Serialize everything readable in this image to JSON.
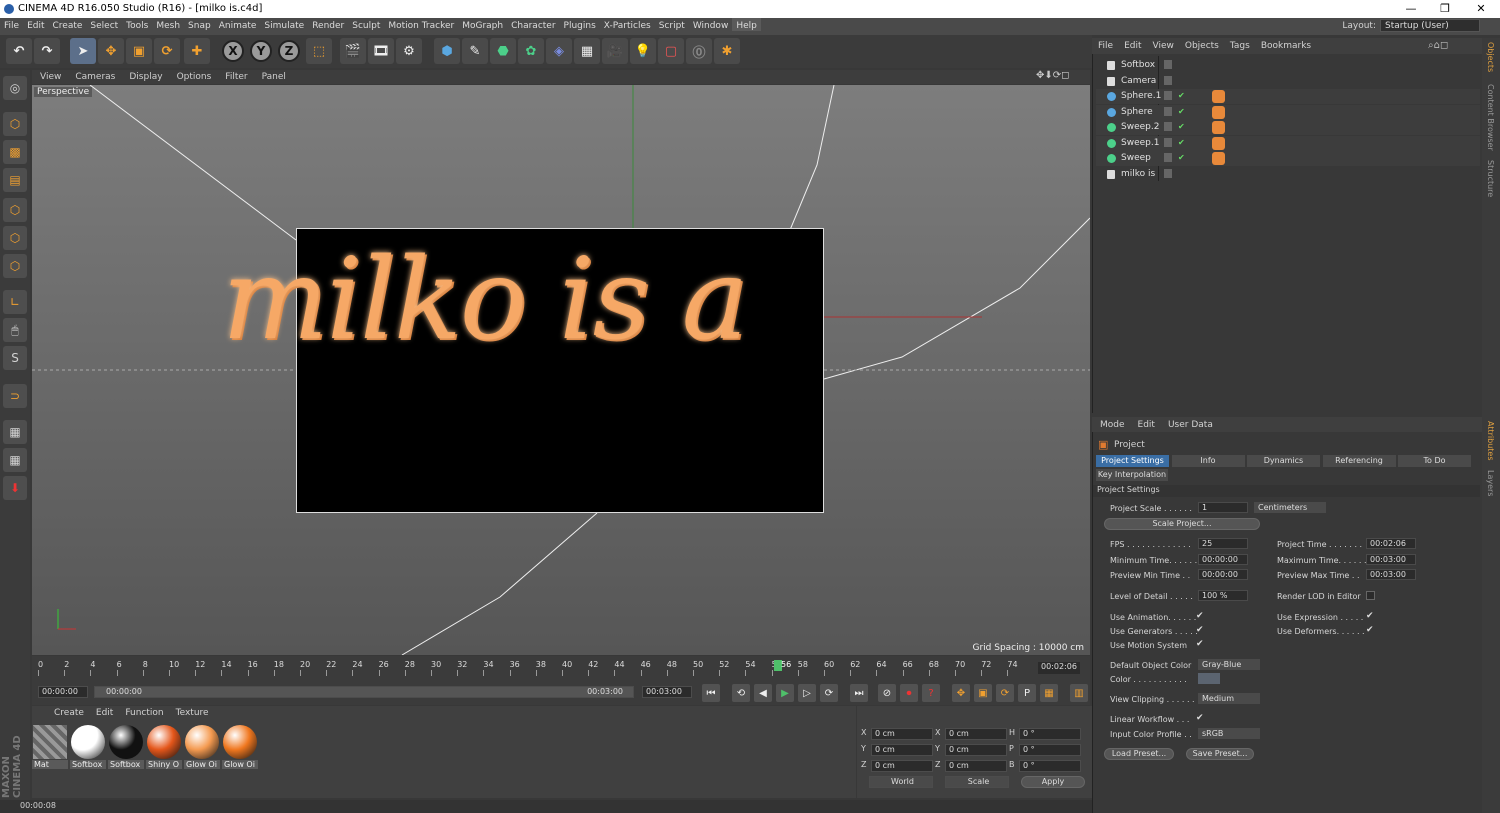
{
  "window": {
    "title": "CINEMA 4D R16.050 Studio (R16) - [milko is.c4d]",
    "min": "—",
    "max": "❐",
    "close": "✕"
  },
  "menu": [
    "File",
    "Edit",
    "Create",
    "Select",
    "Tools",
    "Mesh",
    "Snap",
    "Animate",
    "Simulate",
    "Render",
    "Sculpt",
    "Motion Tracker",
    "MoGraph",
    "Character",
    "Plugins",
    "X-Particles",
    "Script",
    "Window",
    "Help"
  ],
  "layout": {
    "label": "Layout:",
    "value": "Startup (User)"
  },
  "toolbar": {
    "x": "X",
    "y": "Y",
    "z": "Z"
  },
  "viewport": {
    "menu": [
      "View",
      "Cameras",
      "Display",
      "Options",
      "Filter",
      "Panel"
    ],
    "label": "Perspective",
    "grid_spacing": "Grid Spacing : 10000 cm",
    "render_text": "milko is a"
  },
  "timeline": {
    "ticks": [
      "0",
      "2",
      "4",
      "6",
      "8",
      "10",
      "12",
      "14",
      "16",
      "18",
      "20",
      "22",
      "24",
      "26",
      "28",
      "30",
      "32",
      "34",
      "36",
      "38",
      "40",
      "42",
      "44",
      "46",
      "48",
      "50",
      "52",
      "54",
      "56",
      "58",
      "60",
      "62",
      "64",
      "66",
      "68",
      "70",
      "72",
      "74"
    ],
    "current_frame": "56",
    "end_time": "00:02:06"
  },
  "transport": {
    "start": "00:00:00",
    "range_start": "00:00:00",
    "range_end": "00:03:00",
    "end": "00:03:00"
  },
  "materials": {
    "menu": [
      "Create",
      "Edit",
      "Function",
      "Texture"
    ],
    "items": [
      {
        "name": "Mat",
        "color": "#888"
      },
      {
        "name": "Softbox",
        "color": "#ffffff"
      },
      {
        "name": "Softbox",
        "color": "#111111"
      },
      {
        "name": "Shiny O",
        "color": "#e4561a"
      },
      {
        "name": "Glow Oi",
        "color": "#f49a50"
      },
      {
        "name": "Glow Oi",
        "color": "#f0771f"
      }
    ]
  },
  "coords": {
    "header": [
      "--",
      "--",
      "--"
    ],
    "rows": [
      [
        "X",
        "0 cm",
        "X",
        "0 cm",
        "H",
        "0 °"
      ],
      [
        "Y",
        "0 cm",
        "Y",
        "0 cm",
        "P",
        "0 °"
      ],
      [
        "Z",
        "0 cm",
        "Z",
        "0 cm",
        "B",
        "0 °"
      ]
    ],
    "world": "World",
    "scale": "Scale",
    "apply": "Apply"
  },
  "status": {
    "time": "00:00:08"
  },
  "maxon": "MAXON CINEMA 4D",
  "objects": {
    "menu": [
      "File",
      "Edit",
      "View",
      "Objects",
      "Tags",
      "Bookmarks"
    ],
    "items": [
      {
        "name": "Softbox",
        "icon": "#ddd"
      },
      {
        "name": "Camera",
        "icon": "#ddd"
      },
      {
        "name": "Sphere.1",
        "icon": "#5aa7e0"
      },
      {
        "name": "Sphere",
        "icon": "#5aa7e0"
      },
      {
        "name": "Sweep.2",
        "icon": "#4cd08a"
      },
      {
        "name": "Sweep.1",
        "icon": "#4cd08a"
      },
      {
        "name": "Sweep",
        "icon": "#4cd08a"
      },
      {
        "name": "milko is",
        "icon": "#ddd"
      }
    ]
  },
  "attributes": {
    "menu": [
      "Mode",
      "Edit",
      "User Data"
    ],
    "object": "Project",
    "tabs": [
      "Project Settings",
      "Info",
      "Dynamics",
      "Referencing",
      "To Do"
    ],
    "tab2": "Key Interpolation",
    "section": "Project Settings",
    "project_scale": {
      "label": "Project Scale . . . . . .",
      "value": "1",
      "unit": "Centimeters"
    },
    "scale_button": "Scale Project...",
    "left": [
      {
        "label": "FPS . . . . . . . . . . . . .",
        "value": "25"
      },
      {
        "label": "Minimum Time. . . . . .",
        "value": "00:00:00"
      },
      {
        "label": "Preview Min Time . .",
        "value": "00:00:00"
      }
    ],
    "right": [
      {
        "label": "Project Time . . . . . . .",
        "value": "00:02:06"
      },
      {
        "label": "Maximum Time. . . . . .",
        "value": "00:03:00"
      },
      {
        "label": "Preview Max Time . .",
        "value": "00:03:00"
      }
    ],
    "lod": {
      "label": "Level of Detail . . . . .",
      "value": "100 %",
      "render_lod": "Render LOD in Editor"
    },
    "checks_left": [
      "Use Animation. . . . . .",
      "Use Generators . . . . .",
      "Use Motion System"
    ],
    "checks_right": [
      "Use Expression . . . . .",
      "Use Deformers. . . . . ."
    ],
    "default_color": {
      "label": "Default Object Color",
      "value": "Gray-Blue"
    },
    "color": {
      "label": "Color . . . . . . . . . . ."
    },
    "view_clipping": {
      "label": "View Clipping . . . . . .",
      "value": "Medium"
    },
    "linear_workflow": "Linear Workflow . . .",
    "input_color": {
      "label": "Input Color Profile . .",
      "value": "sRGB"
    },
    "load_preset": "Load Preset...",
    "save_preset": "Save Preset..."
  },
  "right_tabs": [
    "Objects",
    "Content Browser",
    "Structure",
    "Attributes",
    "Layers"
  ]
}
